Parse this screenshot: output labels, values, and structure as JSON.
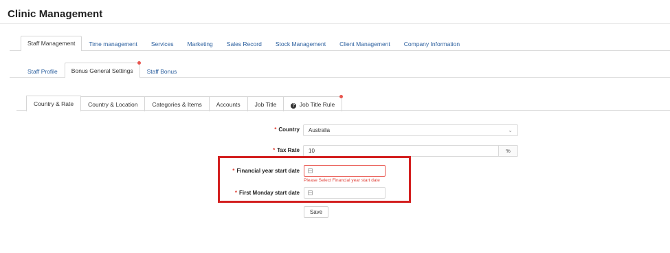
{
  "app": {
    "title": "Clinic Management"
  },
  "main_tabs": [
    {
      "label": "Staff Management",
      "active": true
    },
    {
      "label": "Time management",
      "active": false
    },
    {
      "label": "Services",
      "active": false
    },
    {
      "label": "Marketing",
      "active": false
    },
    {
      "label": "Sales Record",
      "active": false
    },
    {
      "label": "Stock Management",
      "active": false
    },
    {
      "label": "Client Management",
      "active": false
    },
    {
      "label": "Company Information",
      "active": false
    }
  ],
  "sub_tabs": [
    {
      "label": "Staff Profile",
      "active": false
    },
    {
      "label": "Bonus General Settings",
      "active": true,
      "badge": true
    },
    {
      "label": "Staff Bonus",
      "active": false
    }
  ],
  "settings_tabs": [
    {
      "label": "Country & Rate",
      "active": true
    },
    {
      "label": "Country & Location",
      "active": false
    },
    {
      "label": "Categories & Items",
      "active": false
    },
    {
      "label": "Accounts",
      "active": false
    },
    {
      "label": "Job Title",
      "active": false
    },
    {
      "label": "Job Title Rule",
      "active": false,
      "icon": "question-circle-icon",
      "badge": true
    }
  ],
  "form": {
    "required_mark": "*",
    "country": {
      "label": "Country",
      "value": "Australia",
      "icon": "chevron-down-icon"
    },
    "tax_rate": {
      "label": "Tax Rate",
      "value": "10",
      "addon": "%"
    },
    "financial_year": {
      "label": "Financial year start date",
      "value": "",
      "icon": "calendar-icon",
      "error": "Please Select Financial year start date"
    },
    "first_monday": {
      "label": "First Monday start date",
      "value": "",
      "icon": "calendar-icon"
    },
    "save_label": "Save"
  },
  "colors": {
    "link": "#2b5f9e",
    "error": "#e0443c",
    "highlight": "#d32020",
    "badge": "#e8554e"
  }
}
